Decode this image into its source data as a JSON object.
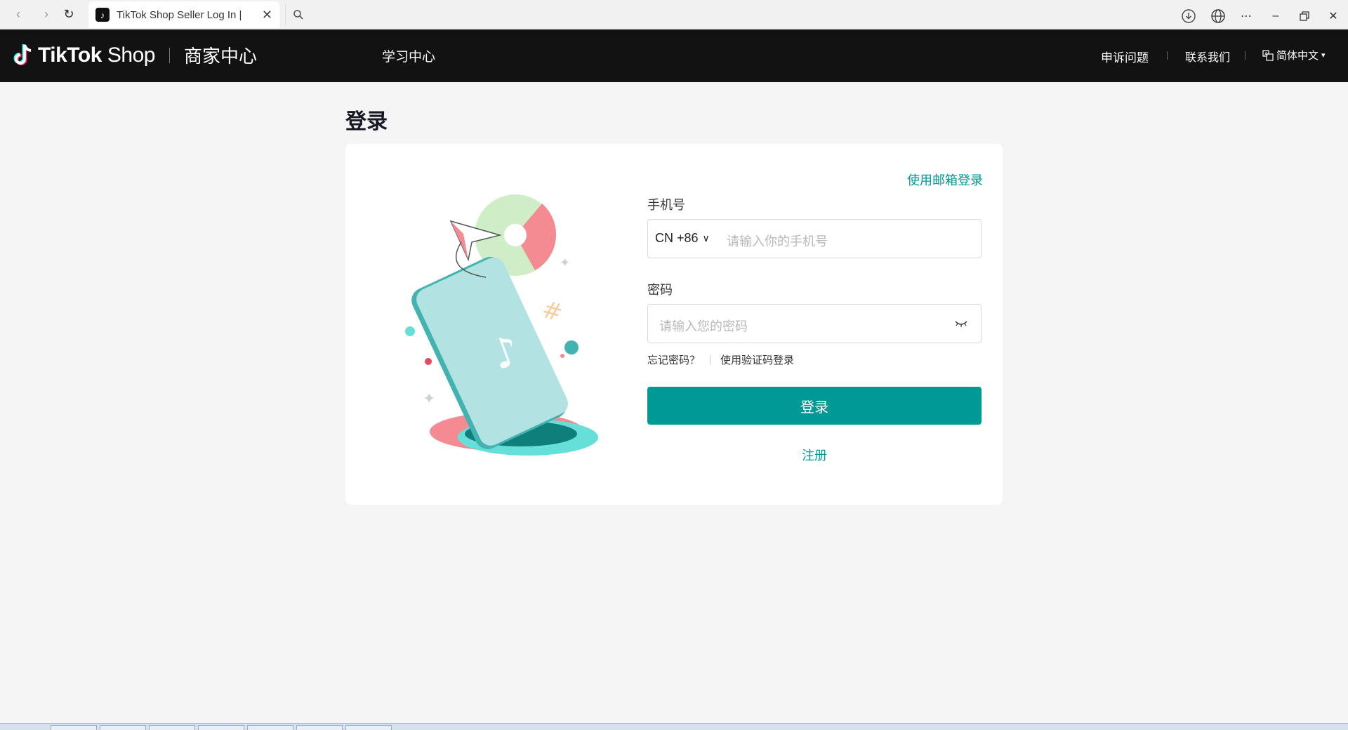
{
  "browser": {
    "tab_title": "TikTok Shop Seller Log In |",
    "close_glyph": "✕",
    "back_glyph": "‹",
    "forward_glyph": "›",
    "reload_glyph": "↻"
  },
  "header": {
    "brand": "TikTok",
    "brand_shop": "Shop",
    "center_label": "商家中心",
    "learn_center": "学习中心",
    "appeal": "申诉问题",
    "contact": "联系我们",
    "language": "简体中文"
  },
  "page": {
    "title": "登录"
  },
  "form": {
    "email_login": "使用邮箱登录",
    "phone_label": "手机号",
    "country_code": "CN +86",
    "phone_placeholder": "请输入你的手机号",
    "password_label": "密码",
    "password_placeholder": "请输入您的密码",
    "forgot_password": "忘记密码？",
    "code_login": "使用验证码登录",
    "login_button": "登录",
    "register": "注册"
  },
  "colors": {
    "accent": "#009995",
    "header_bg": "#121212",
    "page_bg": "#f5f5f5"
  },
  "icons": [
    "tiktok-logo-icon",
    "search-icon",
    "download-icon",
    "globe-icon",
    "more-icon",
    "minimize-icon",
    "restore-icon",
    "close-icon",
    "translate-icon",
    "chevron-down-icon",
    "eye-closed-icon"
  ]
}
